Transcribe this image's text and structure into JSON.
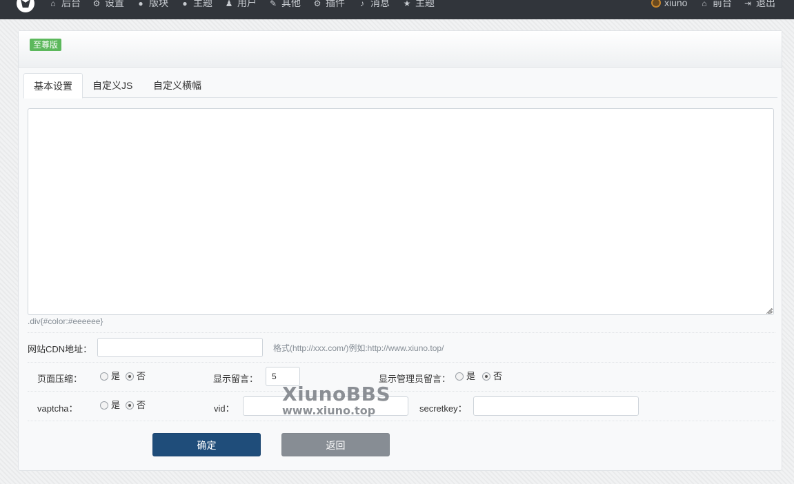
{
  "nav": {
    "items": [
      {
        "icon": "home-icon",
        "glyph": "⌂",
        "label": "后台"
      },
      {
        "icon": "gear-icon",
        "glyph": "⚙",
        "label": "设置"
      },
      {
        "icon": "comment-icon",
        "glyph": "●",
        "label": "版块"
      },
      {
        "icon": "comment-icon",
        "glyph": "●",
        "label": "主题"
      },
      {
        "icon": "user-icon",
        "glyph": "♟",
        "label": "用户"
      },
      {
        "icon": "wrench-icon",
        "glyph": "✎",
        "label": "其他"
      },
      {
        "icon": "gears-icon",
        "glyph": "⚙",
        "label": "插件"
      },
      {
        "icon": "bell-icon",
        "glyph": "♪",
        "label": "消息"
      },
      {
        "icon": "star-icon",
        "glyph": "★",
        "label": "主题"
      }
    ],
    "user": "xiuno",
    "front_label": "前台",
    "logout_label": "退出"
  },
  "card": {
    "badge": "至尊版",
    "tabs": [
      "基本设置",
      "自定义JS",
      "自定义横幅"
    ],
    "active_tab": 0
  },
  "form": {
    "css_value": "",
    "css_hint": ".div{#color:#eeeeee}",
    "cdn_label": "网站CDN地址：",
    "cdn_value": "",
    "cdn_hint": "格式(http://xxx.com/)例如:http://www.xiuno.top/",
    "compress_label": "页面压缩：",
    "comment_label": "显示留言：",
    "comment_value": "5",
    "admin_comment_label": "显示管理员留言：",
    "vaptcha_label": "vaptcha：",
    "vid_label": "vid：",
    "vid_value": "",
    "secretkey_label": "secretkey：",
    "secretkey_value": "",
    "yes_label": "是",
    "no_label": "否",
    "compress_selected": "否",
    "admin_comment_selected": "否",
    "vaptcha_selected": "否"
  },
  "buttons": {
    "submit": "确定",
    "back": "返回"
  },
  "watermark": {
    "title": "XiunoBBS",
    "url": "www.xiuno.top"
  },
  "colors": {
    "nav_bg": "#31353b",
    "badge": "#5cb85c",
    "primary": "#1f4d7a",
    "secondary": "#878d94"
  }
}
